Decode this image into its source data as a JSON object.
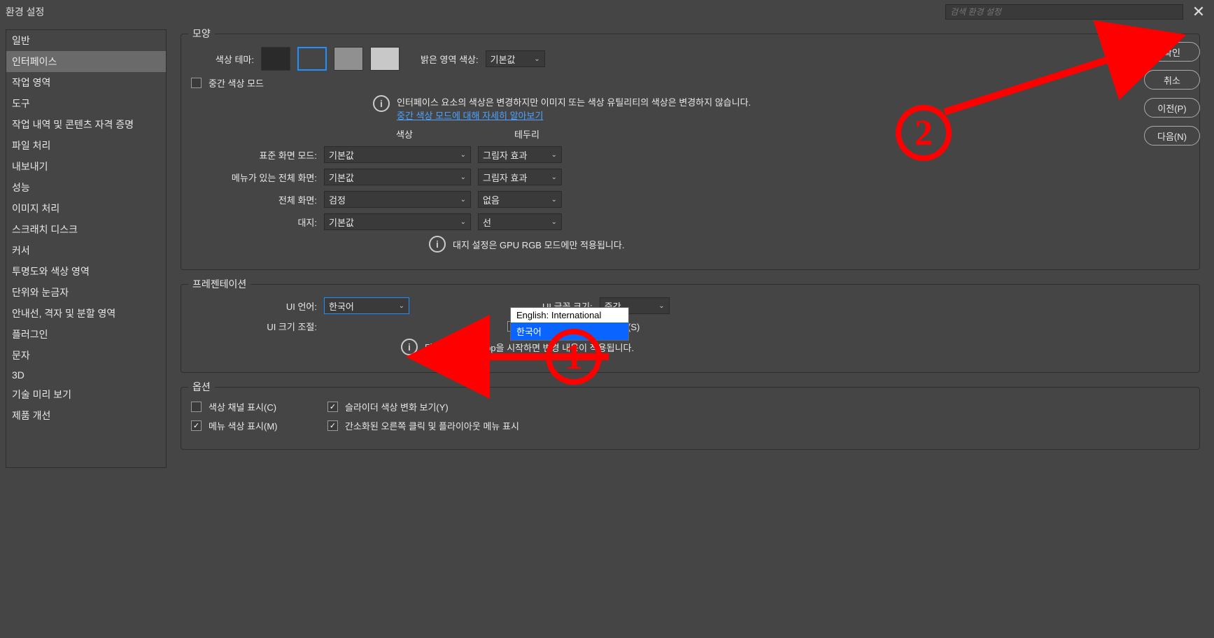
{
  "window": {
    "title": "환경 설정",
    "search_placeholder": "검색 환경 설정"
  },
  "sidebar": {
    "items": [
      "일반",
      "인터페이스",
      "작업 영역",
      "도구",
      "작업 내역 및 콘텐츠 자격 증명",
      "파일 처리",
      "내보내기",
      "성능",
      "이미지 처리",
      "스크래치 디스크",
      "커서",
      "투명도와 색상 영역",
      "단위와 눈금자",
      "안내선, 격자 및 분할 영역",
      "플러그인",
      "문자",
      "3D",
      "기술 미리 보기",
      "제품 개선"
    ],
    "selected_index": 1
  },
  "buttons": {
    "ok": "확인",
    "cancel": "취소",
    "prev": "이전(P)",
    "next": "다음(N)"
  },
  "appearance": {
    "legend": "모양",
    "color_theme_label": "색상 테마:",
    "highlight_label": "밝은 영역 색상:",
    "highlight_value": "기본값",
    "neutral_mode_label": "중간 색상 모드",
    "info_text": "인터페이스 요소의 색상은 변경하지만 이미지 또는 색상 유틸리티의 색상은 변경하지 않습니다.",
    "info_link": "중간 색상 모드에 대해 자세히 알아보기",
    "col_color": "색상",
    "col_border": "테두리",
    "rows": {
      "standard": {
        "label": "표준 화면 모드:",
        "color": "기본값",
        "border": "그림자 효과"
      },
      "menubar": {
        "label": "메뉴가 있는 전체 화면:",
        "color": "기본값",
        "border": "그림자 효과"
      },
      "fullscreen": {
        "label": "전체 화면:",
        "color": "검정",
        "border": "없음"
      },
      "artboard": {
        "label": "대지:",
        "color": "기본값",
        "border": "선"
      }
    },
    "gpu_note": "대지 설정은 GPU RGB 모드에만 적용됩니다."
  },
  "presentation": {
    "legend": "프레젠테이션",
    "ui_lang_label": "UI 언어:",
    "ui_lang_value": "한국어",
    "ui_lang_options": [
      "English: International",
      "한국어"
    ],
    "ui_font_label": "UI 글꼴 크기:",
    "ui_font_value": "중간",
    "ui_scale_label": "UI 크기 조절:",
    "scale_to_font_label": "UI를 글꼴에 맞게 크기 조절(S)",
    "restart_note": "다음에 Photoshop을 시작하면 변경 내용이 적용됩니다."
  },
  "options": {
    "legend": "옵션",
    "color_channels": "색상 채널 표시(C)",
    "dynamic_sliders": "슬라이더 색상 변화 보기(Y)",
    "menu_colors": "메뉴 색상 표시(M)",
    "compact_rclick": "간소화된 오른쪽 클릭 및 플라이아웃 메뉴 표시"
  },
  "annotations": {
    "one": "1",
    "two": "2"
  }
}
